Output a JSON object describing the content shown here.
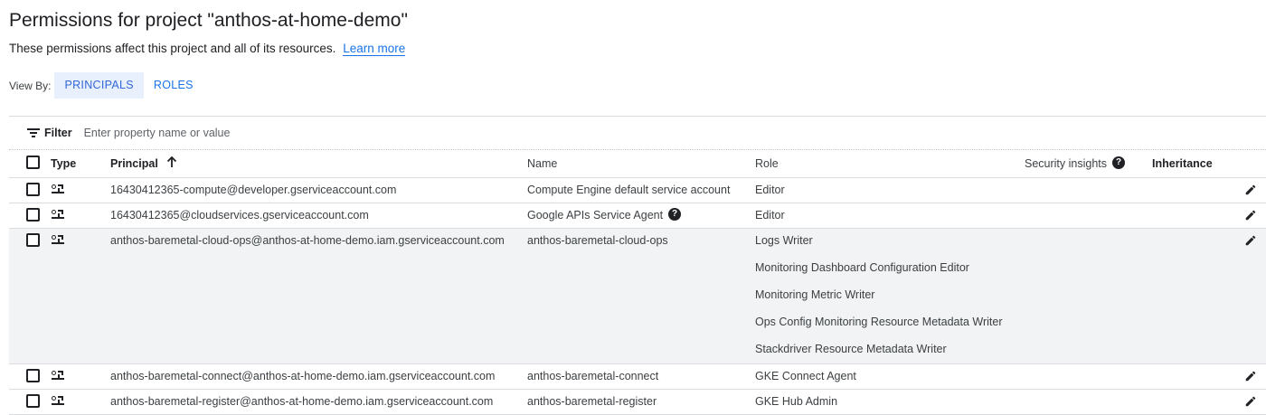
{
  "header": {
    "title": "Permissions for project \"anthos-at-home-demo\"",
    "subtitle": "These permissions affect this project and all of its resources.",
    "learn_more": "Learn more"
  },
  "view_by": {
    "label": "View By:",
    "tabs": [
      "PRINCIPALS",
      "ROLES"
    ],
    "active": "PRINCIPALS"
  },
  "filter": {
    "label": "Filter",
    "placeholder": "Enter property name or value"
  },
  "table": {
    "columns": {
      "type": "Type",
      "principal": "Principal",
      "name": "Name",
      "role": "Role",
      "security_insights": "Security insights",
      "inheritance": "Inheritance"
    },
    "sort": {
      "column": "Principal",
      "direction": "ascending"
    },
    "rows": [
      {
        "principal": "16430412365-compute@developer.gserviceaccount.com",
        "name": "Compute Engine default service account",
        "roles": [
          "Editor"
        ]
      },
      {
        "principal": "16430412365@cloudservices.gserviceaccount.com",
        "name": "Google APIs Service Agent",
        "roles": [
          "Editor"
        ]
      },
      {
        "principal": "anthos-baremetal-cloud-ops@anthos-at-home-demo.iam.gserviceaccount.com",
        "name": "anthos-baremetal-cloud-ops",
        "roles": [
          "Logs Writer",
          "Monitoring Dashboard Configuration Editor",
          "Monitoring Metric Writer",
          "Ops Config Monitoring Resource Metadata Writer",
          "Stackdriver Resource Metadata Writer"
        ]
      },
      {
        "principal": "anthos-baremetal-connect@anthos-at-home-demo.iam.gserviceaccount.com",
        "name": "anthos-baremetal-connect",
        "roles": [
          "GKE Connect Agent"
        ]
      },
      {
        "principal": "anthos-baremetal-register@anthos-at-home-demo.iam.gserviceaccount.com",
        "name": "anthos-baremetal-register",
        "roles": [
          "GKE Hub Admin"
        ]
      }
    ]
  },
  "colors": {
    "accent": "#1a73e8",
    "active_tab_bg": "#e8f0fe",
    "row_highlight": "#f1f3f4",
    "divider": "#dadce0",
    "text": "#202124"
  },
  "icons": {
    "filter": "filter-icon",
    "row_type": "service-account-icon",
    "help": "help-icon",
    "edit": "pencil-icon",
    "sort": "arrow-up-icon"
  }
}
